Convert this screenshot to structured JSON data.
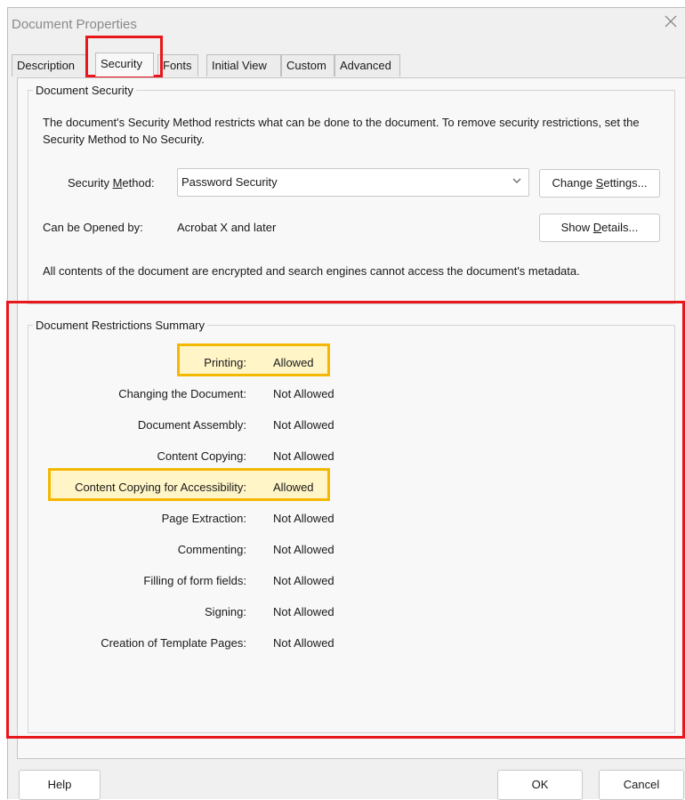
{
  "window": {
    "title": "Document Properties"
  },
  "tabs": [
    {
      "label": "Description"
    },
    {
      "label": "Security"
    },
    {
      "label": "Fonts"
    },
    {
      "label": "Initial View"
    },
    {
      "label": "Custom"
    },
    {
      "label": "Advanced"
    }
  ],
  "security": {
    "group_title": "Document Security",
    "intro": "The document's Security Method restricts what can be done to the document. To remove security restrictions, set the Security Method to No Security.",
    "method_label_pre": "Security ",
    "method_label_mnemonic": "M",
    "method_label_post": "ethod:",
    "method_value": "Password Security",
    "change_settings_pre": "Change ",
    "change_settings_mnemonic": "S",
    "change_settings_post": "ettings...",
    "opened_by_label": "Can be Opened by:",
    "opened_by_value": "Acrobat X and later",
    "show_details_pre": "Show ",
    "show_details_mnemonic": "D",
    "show_details_post": "etails...",
    "encryption_note": "All contents of the document are encrypted and search engines cannot access the document's metadata."
  },
  "restrictions": {
    "group_title": "Document Restrictions Summary",
    "items": [
      {
        "label": "Printing:",
        "value": "Allowed"
      },
      {
        "label": "Changing the Document:",
        "value": "Not Allowed"
      },
      {
        "label": "Document Assembly:",
        "value": "Not Allowed"
      },
      {
        "label": "Content Copying:",
        "value": "Not Allowed"
      },
      {
        "label": "Content Copying for Accessibility:",
        "value": "Allowed"
      },
      {
        "label": "Page Extraction:",
        "value": "Not Allowed"
      },
      {
        "label": "Commenting:",
        "value": "Not Allowed"
      },
      {
        "label": "Filling of form fields:",
        "value": "Not Allowed"
      },
      {
        "label": "Signing:",
        "value": "Not Allowed"
      },
      {
        "label": "Creation of Template Pages:",
        "value": "Not Allowed"
      }
    ]
  },
  "footer": {
    "help": "Help",
    "ok": "OK",
    "cancel": "Cancel"
  },
  "colors": {
    "annotation_red": "#e8171c",
    "annotation_yellow": "#f5b800",
    "highlight_fill": "#fff5c7"
  }
}
